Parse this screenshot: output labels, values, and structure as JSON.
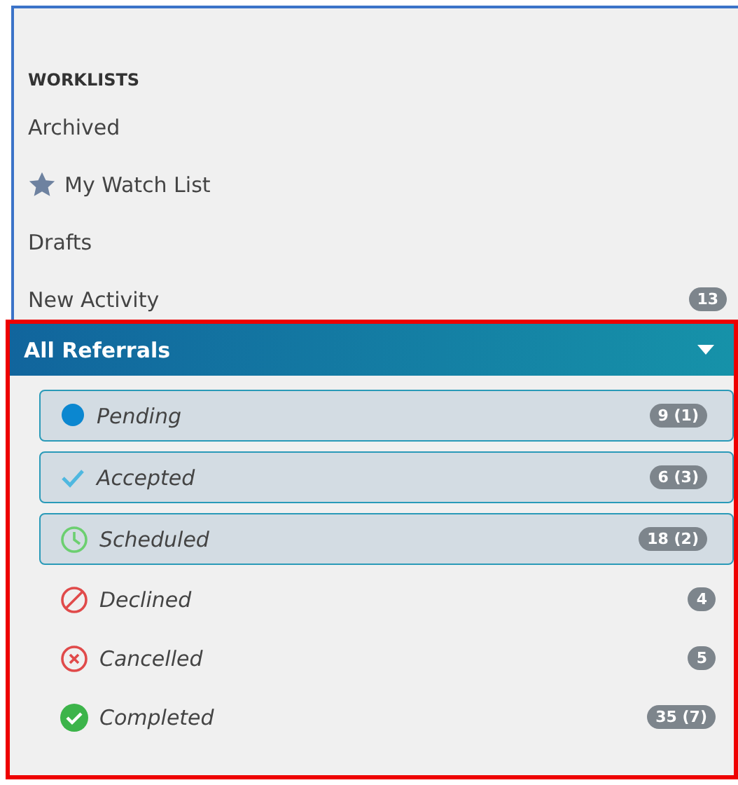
{
  "worklists": {
    "heading": "WORKLISTS",
    "items": [
      {
        "label": "Archived",
        "kind": "plain"
      },
      {
        "label": "My Watch List",
        "kind": "star"
      },
      {
        "label": "Drafts",
        "kind": "plain"
      },
      {
        "label": "New Activity",
        "kind": "plain",
        "count": "13"
      }
    ]
  },
  "referrals": {
    "title": "All Referrals",
    "expanded": true,
    "items": [
      {
        "label": "Pending",
        "kind": "dot",
        "count": "9 (1)",
        "selected": true
      },
      {
        "label": "Accepted",
        "kind": "check",
        "count": "6 (3)",
        "selected": true
      },
      {
        "label": "Scheduled",
        "kind": "clock",
        "count": "18 (2)",
        "selected": true
      },
      {
        "label": "Declined",
        "kind": "ban",
        "count": "4",
        "selected": false
      },
      {
        "label": "Cancelled",
        "kind": "cross",
        "count": "5",
        "selected": false
      },
      {
        "label": "Completed",
        "kind": "done",
        "count": "35 (7)",
        "selected": false
      }
    ]
  }
}
